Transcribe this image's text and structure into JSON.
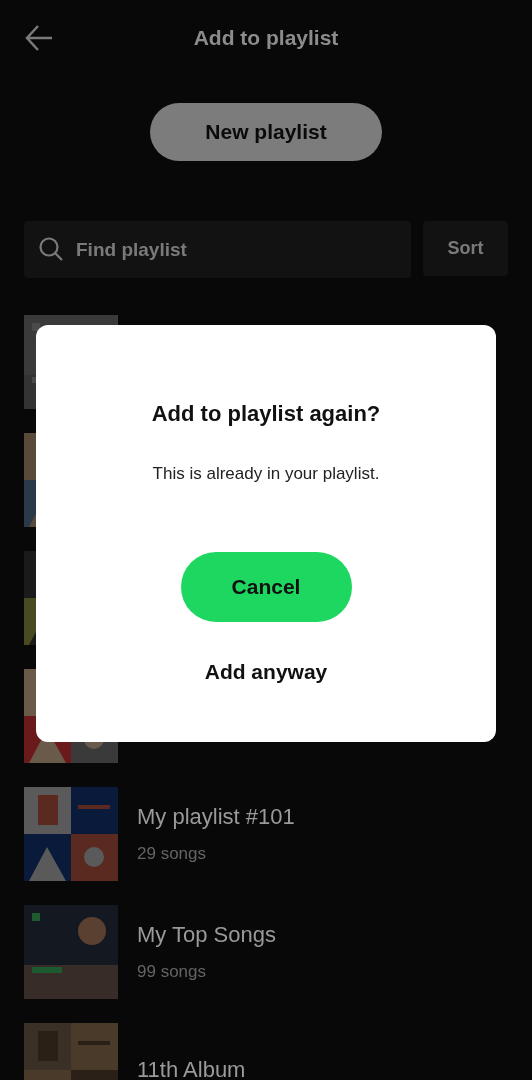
{
  "header": {
    "title": "Add to playlist"
  },
  "new_playlist_button": {
    "label": "New playlist"
  },
  "search": {
    "placeholder": "Find playlist"
  },
  "sort_button": {
    "label": "Sort"
  },
  "playlists": [
    {
      "kind": "single"
    },
    {
      "kind": "mosaic"
    },
    {
      "kind": "mosaic"
    },
    {
      "kind": "mosaic"
    },
    {
      "kind": "mosaic",
      "title": "My playlist #101",
      "subtitle": "29 songs"
    },
    {
      "kind": "single",
      "title": "My Top Songs",
      "subtitle": "99 songs"
    },
    {
      "kind": "mosaic",
      "title": "11th Album"
    }
  ],
  "dialog": {
    "title": "Add to playlist again?",
    "message": "This is already in your playlist.",
    "primary_button": "Cancel",
    "secondary_button": "Add anyway"
  }
}
